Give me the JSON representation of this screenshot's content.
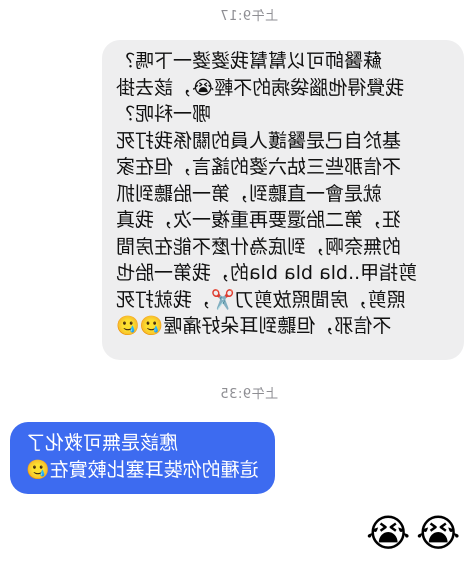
{
  "conversation": {
    "timestamps": [
      "上午9:17",
      "上午9:35"
    ],
    "incoming_message": {
      "lines": [
        "蘇醫師可以幫幫我婆婆一下嗎？",
        "我覺得他腦袋病的不輕😭，該去掛",
        "哪一科呢？",
        "基於自己是醫護人員的關係我打死",
        "不信那些三姑六婆的謠言，但在家",
        "就是會一直聽到，第一胎聽到抓",
        "狂，第二胎還要再重複一次，我真",
        "的無奈啊，到底為什麼不能在房間",
        "剪指甲..bla bla bla的，我第一胎也",
        "照剪，房間照放剪刀✂️，我就打死",
        "不信邪，但聽到耳朵好痛喔🥲🥲"
      ]
    },
    "outgoing_message": {
      "lines": [
        "應該是無可救化了",
        "這種的你裝耳塞比較實在🥲"
      ]
    },
    "reaction_emojis": [
      "😭",
      "😭"
    ]
  }
}
